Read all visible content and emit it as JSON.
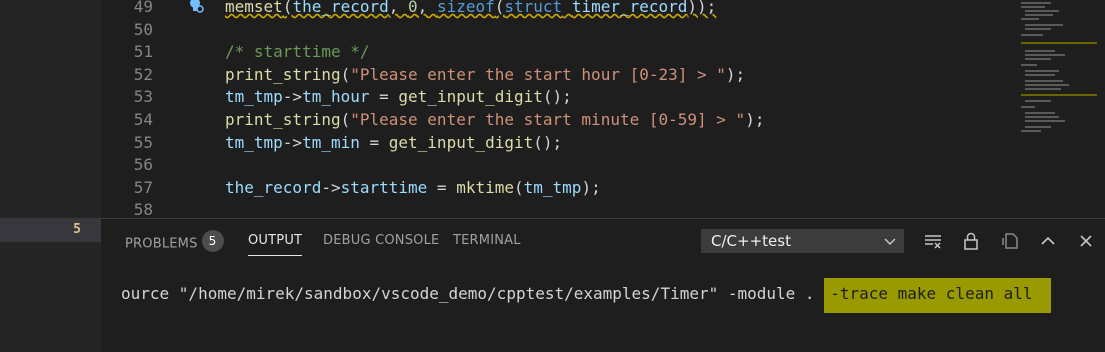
{
  "activity": {
    "badge": "5"
  },
  "editor": {
    "lines": [
      {
        "num": "49",
        "text": "memset(the_record, 0, sizeof(struct timer_record));"
      },
      {
        "num": "50",
        "text": ""
      },
      {
        "num": "51",
        "text": "/* starttime */"
      },
      {
        "num": "52",
        "text": "print_string(\"Please enter the start hour [0-23] > \");"
      },
      {
        "num": "53",
        "text": "tm_tmp->tm_hour = get_input_digit();"
      },
      {
        "num": "54",
        "text": "print_string(\"Please enter the start minute [0-59] > \");"
      },
      {
        "num": "55",
        "text": "tm_tmp->tm_min = get_input_digit();"
      },
      {
        "num": "56",
        "text": ""
      },
      {
        "num": "57",
        "text": "the_record->starttime = mktime(tm_tmp);"
      },
      {
        "num": "58",
        "text": ""
      }
    ],
    "tokens": {
      "l49_fn": "memset",
      "l49_a": "(",
      "l49_var": "the_record",
      "l49_b": ", ",
      "l49_num": "0",
      "l49_c": ", ",
      "l49_kw1": "sizeof",
      "l49_d": "(",
      "l49_kw2": "struct",
      "l49_e": " ",
      "l49_type": "timer_record",
      "l49_f": "));",
      "l51": "/* starttime */",
      "l52_fn": "print_string",
      "l52_a": "(",
      "l52_str": "\"Please enter the start hour [0-23] > \"",
      "l52_b": ");",
      "l53_v1": "tm_tmp",
      "l53_a": "->",
      "l53_v2": "tm_hour",
      "l53_b": " = ",
      "l53_fn": "get_input_digit",
      "l53_c": "();",
      "l54_fn": "print_string",
      "l54_a": "(",
      "l54_str": "\"Please enter the start minute [0-59] > \"",
      "l54_b": ");",
      "l55_v1": "tm_tmp",
      "l55_a": "->",
      "l55_v2": "tm_min",
      "l55_b": " = ",
      "l55_fn": "get_input_digit",
      "l55_c": "();",
      "l57_v1": "the_record",
      "l57_a": "->",
      "l57_v2": "starttime",
      "l57_b": " = ",
      "l57_fn": "mktime",
      "l57_c": "(",
      "l57_v3": "tm_tmp",
      "l57_d": ");"
    }
  },
  "panel": {
    "tabs": {
      "problems": "PROBLEMS",
      "problems_count": "5",
      "output": "OUTPUT",
      "debug_console": "DEBUG CONSOLE",
      "terminal": "TERMINAL"
    },
    "channel_select": "C/C++test",
    "output_text": "ource \"/home/mirek/sandbox/vscode_demo/cpptest/examples/Timer\" -module . ",
    "output_highlight": "-trace make clean all"
  },
  "colors": {
    "background": "#1e1e1e",
    "highlight": "#999900",
    "badge_text": "#e2c08d"
  }
}
